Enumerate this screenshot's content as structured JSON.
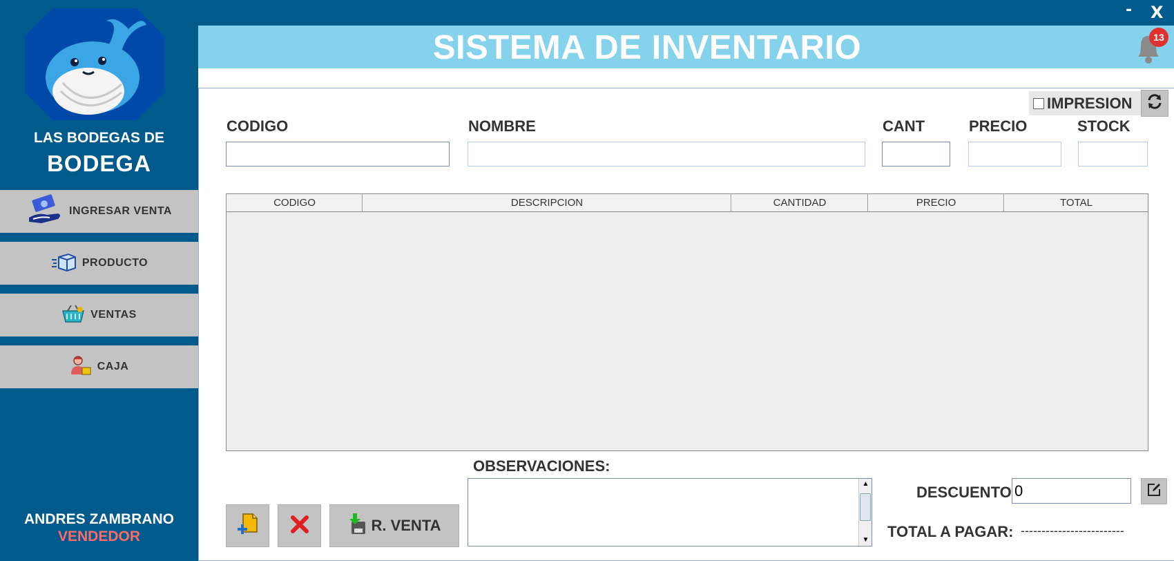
{
  "window": {
    "minimize_label": "-",
    "close_label": "X"
  },
  "sidebar": {
    "brand_line1": "LAS BODEGAS DE",
    "brand_line2": "BODEGA",
    "items": [
      {
        "label": "INGRESAR VENTA",
        "icon": "hand-money-icon"
      },
      {
        "label": "PRODUCTO",
        "icon": "box-icon"
      },
      {
        "label": "VENTAS",
        "icon": "basket-icon"
      },
      {
        "label": "CAJA",
        "icon": "cashier-icon"
      }
    ],
    "user_name": "ANDRES ZAMBRANO",
    "user_role": "VENDEDOR"
  },
  "header": {
    "title": "SISTEMA DE INVENTARIO",
    "notification_count": "13"
  },
  "form": {
    "impresion_label": "IMPRESION",
    "impresion_checked": false,
    "labels": {
      "codigo": "CODIGO",
      "nombre": "NOMBRE",
      "cant": "CANT",
      "precio": "PRECIO",
      "stock": "STOCK"
    },
    "values": {
      "codigo": "",
      "nombre": "",
      "cant": "",
      "precio": "",
      "stock": ""
    }
  },
  "table": {
    "columns": [
      "CODIGO",
      "DESCRIPCION",
      "CANTIDAD",
      "PRECIO",
      "TOTAL"
    ],
    "rows": []
  },
  "footer": {
    "observaciones_label": "OBSERVACIONES:",
    "observaciones_value": "",
    "rventa_label": "R. VENTA",
    "descuento_label": "DESCUENTO:",
    "descuento_value": "0",
    "total_label": "TOTAL A PAGAR:",
    "total_value": "-------------------------"
  },
  "colors": {
    "sidebar_bg": "#005b8c",
    "header_bg": "#84d2ec",
    "button_bg": "#c3c3c3",
    "role_color": "#ff6b6b",
    "badge_color": "#e03131"
  }
}
